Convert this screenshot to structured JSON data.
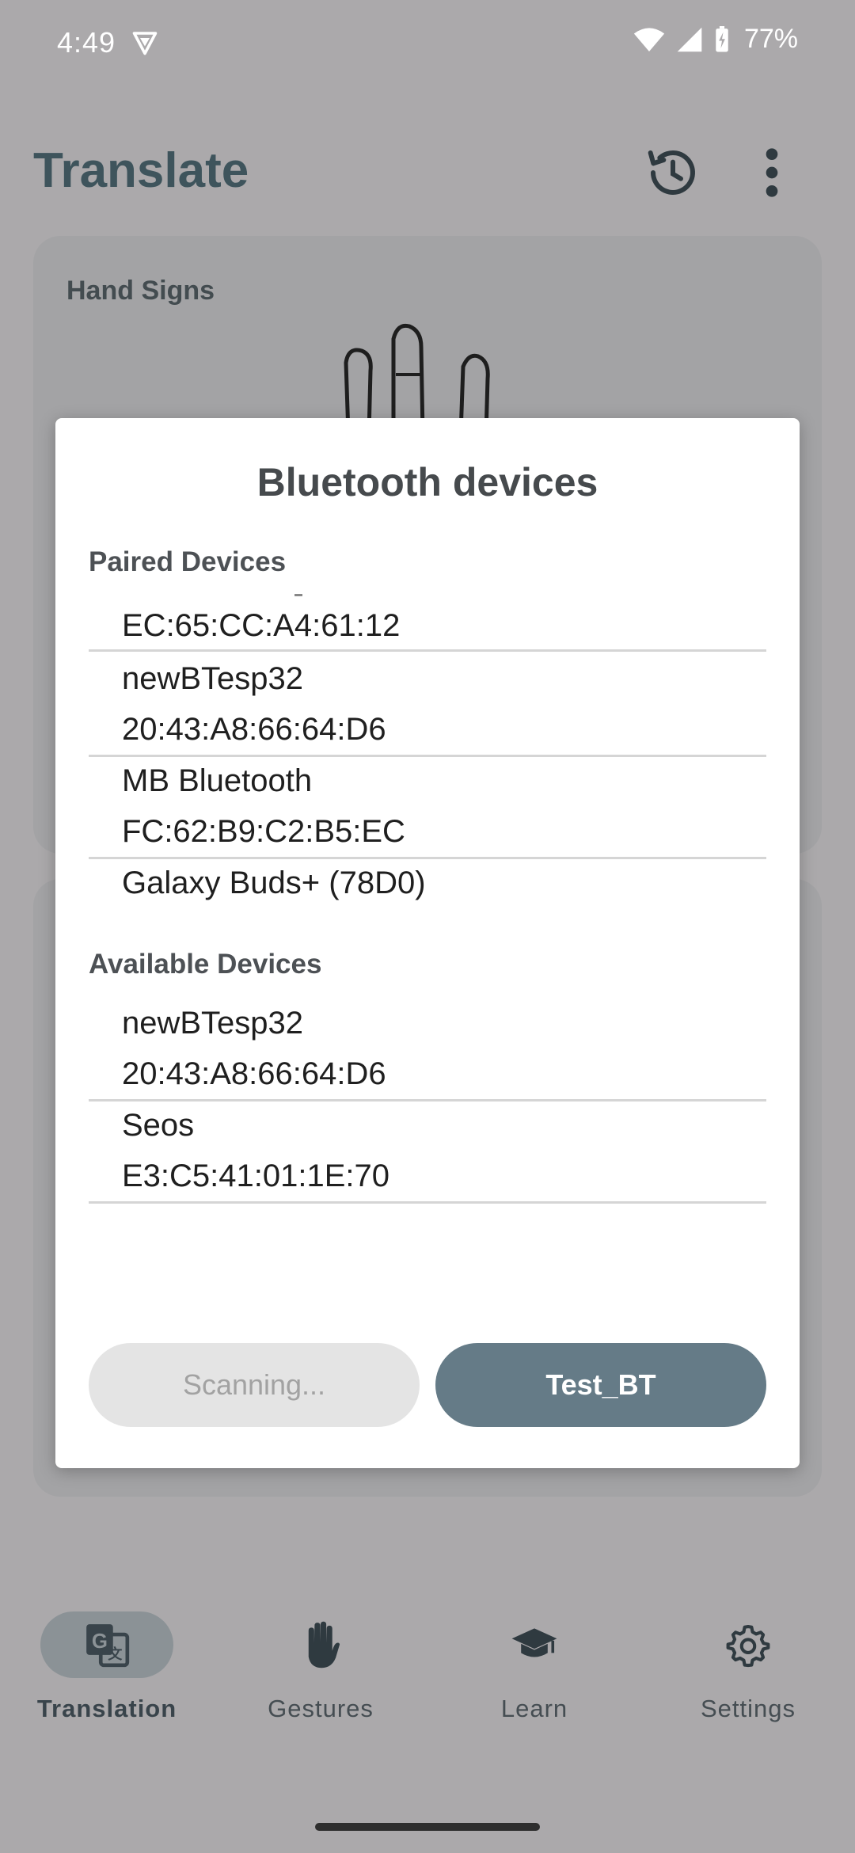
{
  "status": {
    "time": "4:49",
    "battery": "77%"
  },
  "app_bar": {
    "title": "Translate"
  },
  "hand_card": {
    "title": "Hand Signs"
  },
  "dialog": {
    "title": "Bluetooth devices",
    "paired_title": "Paired Devices",
    "paired": [
      {
        "name": "",
        "address": "EC:65:CC:A4:61:12"
      },
      {
        "name": "newBTesp32",
        "address": "20:43:A8:66:64:D6"
      },
      {
        "name": "MB Bluetooth",
        "address": "FC:62:B9:C2:B5:EC"
      },
      {
        "name": "Galaxy Buds+ (78D0)",
        "address": ""
      }
    ],
    "available_title": "Available Devices",
    "available": [
      {
        "name": "newBTesp32",
        "address": "20:43:A8:66:64:D6"
      },
      {
        "name": "Seos",
        "address": "E3:C5:41:01:1E:70"
      }
    ],
    "scan_button": "Scanning...",
    "test_button": "Test_BT"
  },
  "nav": {
    "items": [
      {
        "label": "Translation",
        "icon": "translate-icon",
        "active": true
      },
      {
        "label": "Gestures",
        "icon": "hand-icon",
        "active": false
      },
      {
        "label": "Learn",
        "icon": "graduation-cap-icon",
        "active": false
      },
      {
        "label": "Settings",
        "icon": "gear-icon",
        "active": false
      }
    ]
  },
  "colors": {
    "accent": "#657b87",
    "title": "#3e545c",
    "scrim": "#aba9ab"
  }
}
